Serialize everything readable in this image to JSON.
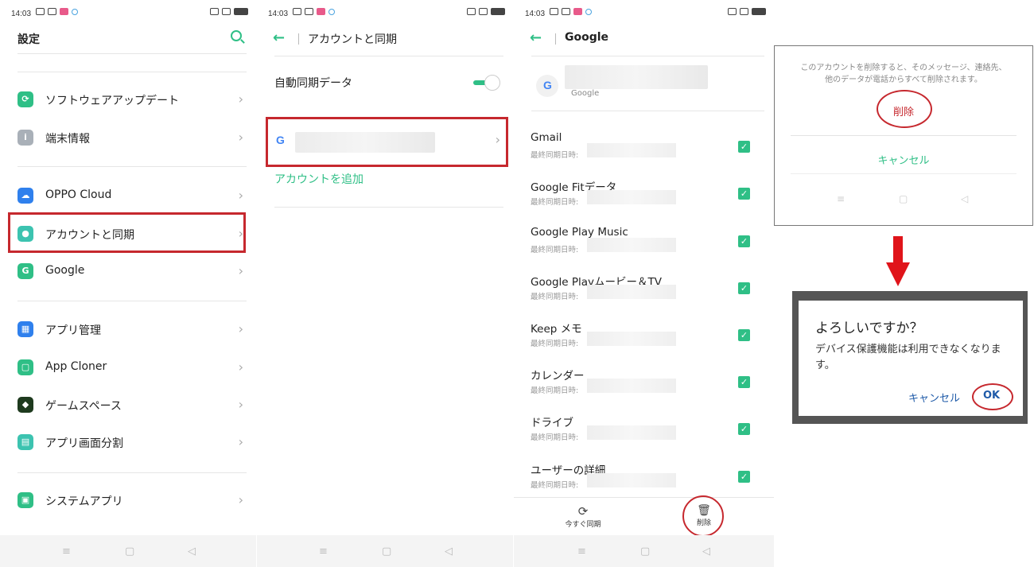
{
  "status_time": "14:03",
  "panel1": {
    "title": "設定",
    "items": [
      {
        "label": "ソフトウェアアップデート",
        "icon": "update-icon",
        "color": "#2fbf86"
      },
      {
        "label": "端末情報",
        "icon": "info-icon",
        "color": "#a9b0b8"
      },
      {
        "label": "OPPO Cloud",
        "icon": "cloud-icon",
        "color": "#2f80ed"
      },
      {
        "label": "アカウントと同期",
        "icon": "account-icon",
        "color": "#3cc3b0"
      },
      {
        "label": "Google",
        "icon": "google-g-icon",
        "color": "#2fbf86"
      },
      {
        "label": "アプリ管理",
        "icon": "apps-grid-icon",
        "color": "#2f80ed"
      },
      {
        "label": "App Cloner",
        "icon": "app-cloner-icon",
        "color": "#2fbf86"
      },
      {
        "label": "ゲームスペース",
        "icon": "game-space-icon",
        "color": "#1e3a1e"
      },
      {
        "label": "アプリ画面分割",
        "icon": "split-screen-icon",
        "color": "#3cc3b0"
      },
      {
        "label": "システムアプリ",
        "icon": "system-app-icon",
        "color": "#2fbf86"
      }
    ]
  },
  "panel2": {
    "title": "アカウントと同期",
    "auto_sync_label": "自動同期データ",
    "auto_sync_on": true,
    "add_account_label": "アカウントを追加"
  },
  "panel3": {
    "title": "Google",
    "account_caption": "Google",
    "sync_items": [
      {
        "title": "Gmail",
        "sub": "最終同期日時:"
      },
      {
        "title": "Google Fitデータ",
        "sub": "最終同期日時:"
      },
      {
        "title": "Google Play Music",
        "sub": "最終同期日時:"
      },
      {
        "title": "Google Playムービー＆TV",
        "sub": "最終同期日時:"
      },
      {
        "title": "Keep メモ",
        "sub": "最終同期日時:"
      },
      {
        "title": "カレンダー",
        "sub": "最終同期日時:"
      },
      {
        "title": "ドライブ",
        "sub": "最終同期日時:"
      },
      {
        "title": "ユーザーの詳細",
        "sub": "最終同期日時:"
      }
    ],
    "sync_now_label": "今すぐ同期",
    "delete_label": "削除"
  },
  "dialog1": {
    "message_line1": "このアカウントを削除すると、そのメッセージ、連絡先、",
    "message_line2": "他のデータが電話からすべて削除されます。",
    "delete_label": "削除",
    "cancel_label": "キャンセル"
  },
  "dialog2": {
    "title": "よろしいですか？",
    "message": "デバイス保護機能は利用できなくなります。",
    "cancel_label": "キャンセル",
    "ok_label": "OK"
  },
  "colors": {
    "accent": "#2fbf86",
    "highlight": "#c6282e",
    "arrow": "#e0141a",
    "link_blue": "#1e5aa8"
  }
}
